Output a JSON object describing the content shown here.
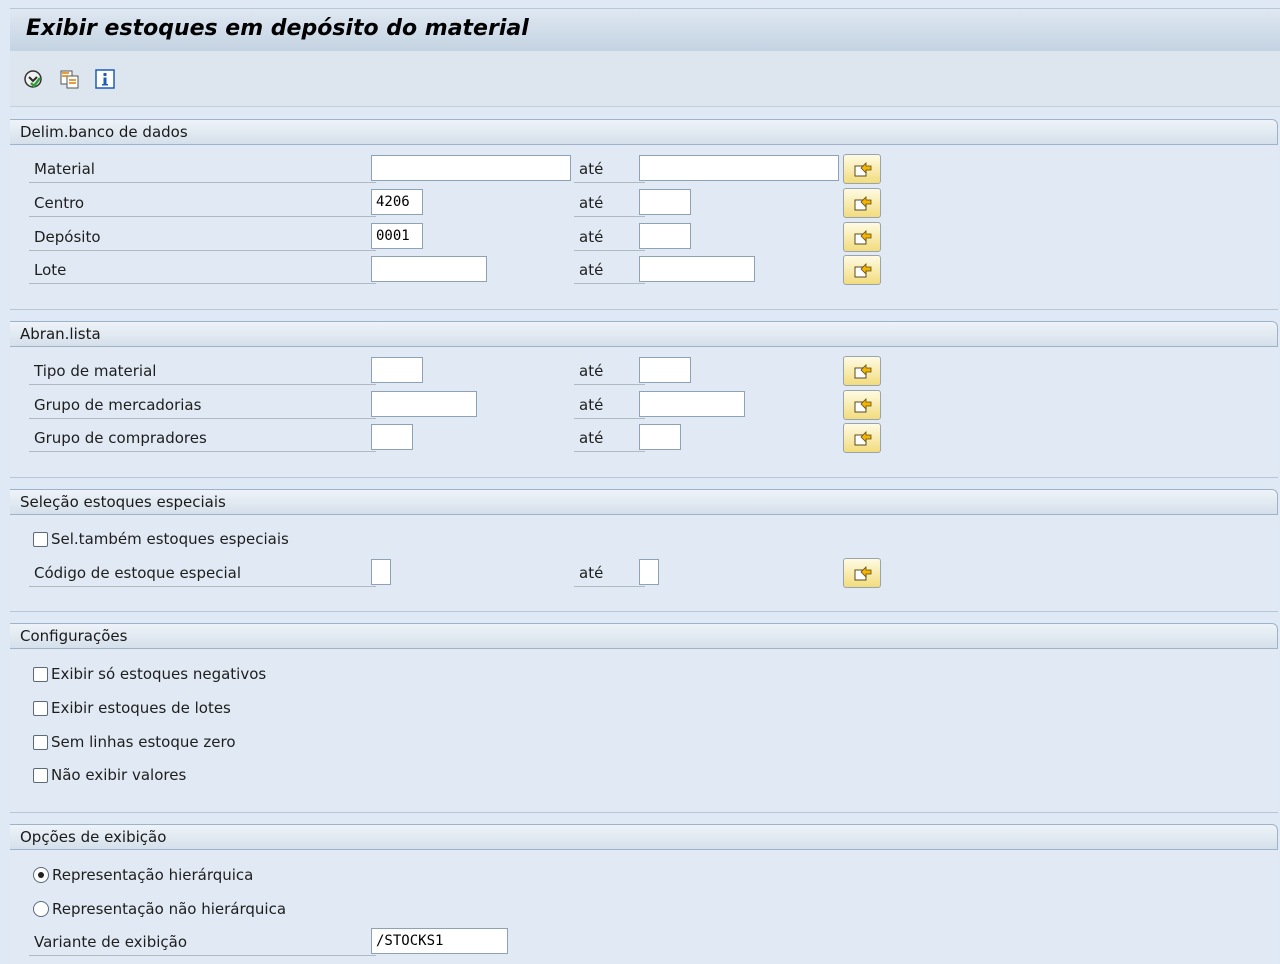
{
  "title": "Exibir estoques em depósito do material",
  "toolbar": {
    "buttons": [
      {
        "icon": "execute-icon"
      },
      {
        "icon": "get-variant-icon"
      },
      {
        "icon": "info-icon"
      }
    ]
  },
  "common": {
    "ate_label": "até"
  },
  "sections": {
    "db": {
      "title": "Delim.banco de dados",
      "material": {
        "label": "Material",
        "from": "",
        "to": ""
      },
      "centro": {
        "label": "Centro",
        "from": "4206",
        "to": ""
      },
      "deposito": {
        "label": "Depósito",
        "from": "0001",
        "to": ""
      },
      "lote": {
        "label": "Lote",
        "from": "",
        "to": ""
      }
    },
    "list": {
      "title": "Abran.lista",
      "tipo": {
        "label": "Tipo de material",
        "from": "",
        "to": ""
      },
      "grupo_merc": {
        "label": "Grupo de mercadorias",
        "from": "",
        "to": ""
      },
      "grupo_comp": {
        "label": "Grupo de compradores",
        "from": "",
        "to": ""
      }
    },
    "special": {
      "title": "Seleção estoques especiais",
      "sel_also": {
        "label": "Sel.também estoques especiais",
        "checked": false
      },
      "codigo": {
        "label": "Código de estoque especial",
        "from": "",
        "to": ""
      }
    },
    "settings": {
      "title": "Configurações",
      "options": [
        {
          "label": "Exibir só estoques negativos",
          "checked": false
        },
        {
          "label": "Exibir estoques de lotes",
          "checked": false
        },
        {
          "label": "Sem linhas estoque zero",
          "checked": false
        },
        {
          "label": "Não exibir valores",
          "checked": false
        }
      ]
    },
    "display": {
      "title": "Opções de exibição",
      "hier": {
        "label": "Representação hierárquica",
        "selected": true
      },
      "nonhier": {
        "label": "Representação não hierárquica",
        "selected": false
      },
      "variant": {
        "label": "Variante de exibição",
        "value": "/STOCKS1"
      }
    }
  },
  "colors": {
    "background": "#dfe9f5",
    "multi_button": "#f2dc7d",
    "header": "#d5e0eb"
  }
}
